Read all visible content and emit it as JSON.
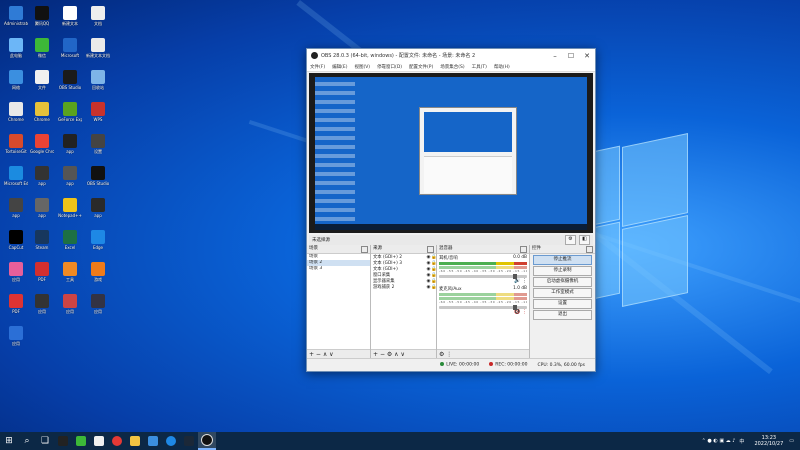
{
  "desktop": {
    "icons": [
      {
        "label": "Administrator",
        "color": "#2f7bd6"
      },
      {
        "label": "腾讯QQ",
        "color": "#111"
      },
      {
        "label": "新建文本",
        "color": "#fff"
      },
      {
        "label": "文档",
        "color": "#eee"
      },
      {
        "label": "此电脑",
        "color": "#6cb6f7"
      },
      {
        "label": "微信",
        "color": "#3db838"
      },
      {
        "label": "Microsoft",
        "color": "#2166c7"
      },
      {
        "label": "新建文本文档",
        "color": "#eaeaea"
      },
      {
        "label": "网络",
        "color": "#3b8fe0"
      },
      {
        "label": "文件",
        "color": "#f0f0f0"
      },
      {
        "label": "OBS Studio",
        "color": "#1b1b1b"
      },
      {
        "label": "回收站",
        "color": "#7db4e8"
      },
      {
        "label": "Chrome",
        "color": "#e8e8e8"
      },
      {
        "label": "Chrome",
        "color": "#e7c23a"
      },
      {
        "label": "GeForce Experience",
        "color": "#5aa31f"
      },
      {
        "label": "WPS",
        "color": "#c8322c"
      },
      {
        "label": "TortoiseGit",
        "color": "#d74a2c"
      },
      {
        "label": "Google Chrome",
        "color": "#ea4335"
      },
      {
        "label": "app",
        "color": "#222"
      },
      {
        "label": "设置",
        "color": "#444"
      },
      {
        "label": "Microsoft Edge",
        "color": "#1b8be0"
      },
      {
        "label": "app",
        "color": "#333"
      },
      {
        "label": "app",
        "color": "#555"
      },
      {
        "label": "OBS Studio",
        "color": "#111"
      },
      {
        "label": "app",
        "color": "#444"
      },
      {
        "label": "app",
        "color": "#666"
      },
      {
        "label": "Notepad++",
        "color": "#f0c419"
      },
      {
        "label": "app",
        "color": "#2a2a2a"
      },
      {
        "label": "CapCut",
        "color": "#000"
      },
      {
        "label": "Steam",
        "color": "#17375e"
      },
      {
        "label": "Excel",
        "color": "#1d7044"
      },
      {
        "label": "Edge",
        "color": "#1e88e5"
      },
      {
        "label": "应用",
        "color": "#e85f9a"
      },
      {
        "label": "PDF",
        "color": "#d32f2f"
      },
      {
        "label": "工具",
        "color": "#f08a24"
      },
      {
        "label": "游戏",
        "color": "#f07b1a"
      },
      {
        "label": "PDF",
        "color": "#d33"
      },
      {
        "label": "应用",
        "color": "#333"
      },
      {
        "label": "应用",
        "color": "#c44"
      },
      {
        "label": "应用",
        "color": "#334"
      },
      {
        "label": "应用",
        "color": "#2b6fd6"
      }
    ]
  },
  "obs": {
    "title": "OBS 28.0.3 (64-bit, windows) - 配置文件: 未命名 - 场景: 未命名 2",
    "menu": [
      "文件(F)",
      "编辑(E)",
      "视图(V)",
      "停靠窗口(D)",
      "配置文件(P)",
      "场景集合(S)",
      "工具(T)",
      "帮助(H)"
    ],
    "scene_bar": {
      "label": "未选择源",
      "gear": "⚙",
      "filter": "◧"
    },
    "scenes": {
      "header": "场景",
      "items": [
        "场景",
        "场景 2",
        "场景 3"
      ],
      "selected": 1,
      "footer": "+ − ∧ ∨"
    },
    "sources": {
      "header": "来源",
      "items": [
        "文本 (GDI+) 2",
        "文本 (GDI+) 3",
        "文本 (GDI+)",
        "窗口采集",
        "显示器采集",
        "游戏捕获 2"
      ],
      "footer": "+ − ⚙ ∧ ∨"
    },
    "mixer": {
      "header": "混音器",
      "channels": [
        {
          "name": "耳机/音响",
          "db": "0.0 dB",
          "ticks": "-60 -55 -50 -45 -40 -35 -30 -25 -20 -15 -10 -5 0"
        },
        {
          "name": "麦克风/Aux",
          "db": "1.0 dB",
          "ticks": "-60 -55 -50 -45 -40 -35 -30 -25 -20 -15 -10 -5 0"
        }
      ],
      "footer": "⚙ ⋮"
    },
    "controls": {
      "header": "控件",
      "buttons": [
        "停止推流",
        "停止录制",
        "启动虚拟摄像机",
        "工作室模式",
        "设置",
        "退出"
      ]
    },
    "status": {
      "live": "LIVE: 00:00:00",
      "rec": "REC: 00:00:00",
      "cpu": "CPU: 0.3%, 60.00 fps"
    }
  },
  "taskbar": {
    "time": "13:23",
    "date": "2022/10/27",
    "lang": "中"
  },
  "colors": {
    "desktop": "#0a63d8",
    "taskbar": "#0c2846",
    "live": "#2a8b3a",
    "rec": "#c82828"
  }
}
